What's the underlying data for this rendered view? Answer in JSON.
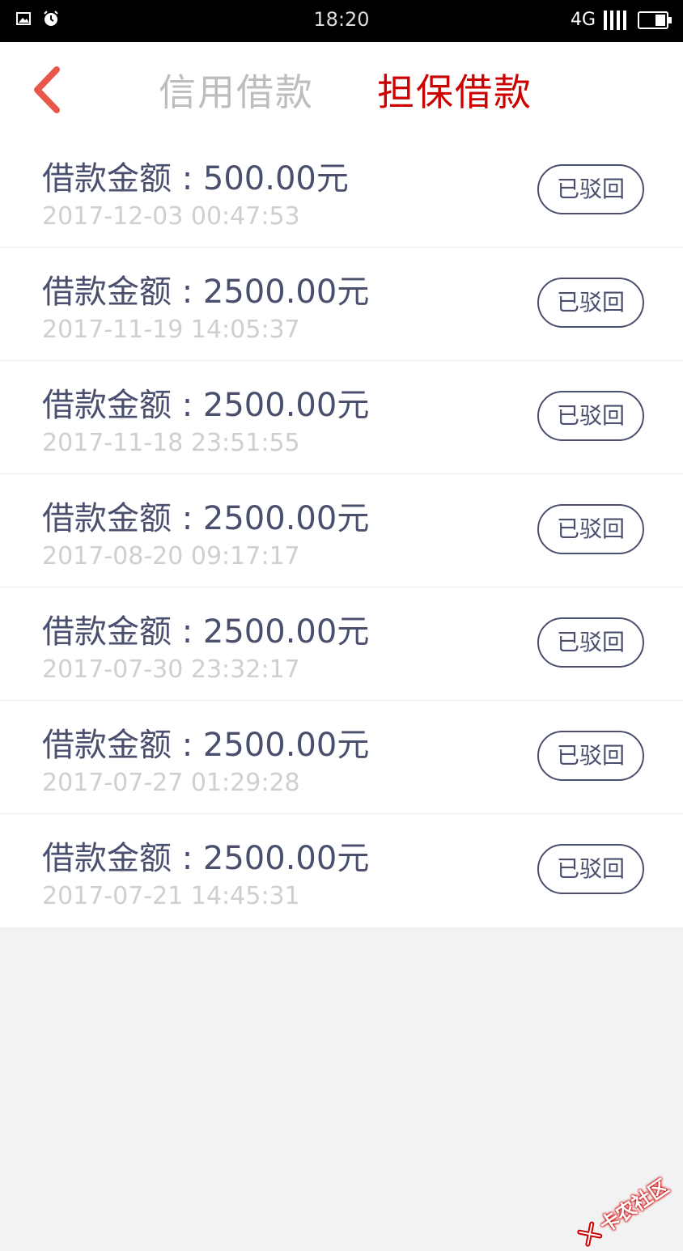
{
  "status_bar": {
    "time": "18:20",
    "network": "4G"
  },
  "header": {
    "tabs": [
      {
        "label": "信用借款",
        "active": false
      },
      {
        "label": "担保借款",
        "active": true
      }
    ],
    "colors": {
      "active": "#cc0000",
      "inactive": "#bdbdbd",
      "back": "#e8584a"
    }
  },
  "loans": [
    {
      "amount": "借款金额 : 500.00元",
      "time": "2017-12-03 00:47:53",
      "status": "已驳回"
    },
    {
      "amount": "借款金额 : 2500.00元",
      "time": "2017-11-19 14:05:37",
      "status": "已驳回"
    },
    {
      "amount": "借款金额 : 2500.00元",
      "time": "2017-11-18 23:51:55",
      "status": "已驳回"
    },
    {
      "amount": "借款金额 : 2500.00元",
      "time": "2017-08-20 09:17:17",
      "status": "已驳回"
    },
    {
      "amount": "借款金额 : 2500.00元",
      "time": "2017-07-30 23:32:17",
      "status": "已驳回"
    },
    {
      "amount": "借款金额 : 2500.00元",
      "time": "2017-07-27 01:29:28",
      "status": "已驳回"
    },
    {
      "amount": "借款金额 : 2500.00元",
      "time": "2017-07-21 14:45:31",
      "status": "已驳回"
    }
  ],
  "watermark": {
    "text": "卡农社区"
  }
}
